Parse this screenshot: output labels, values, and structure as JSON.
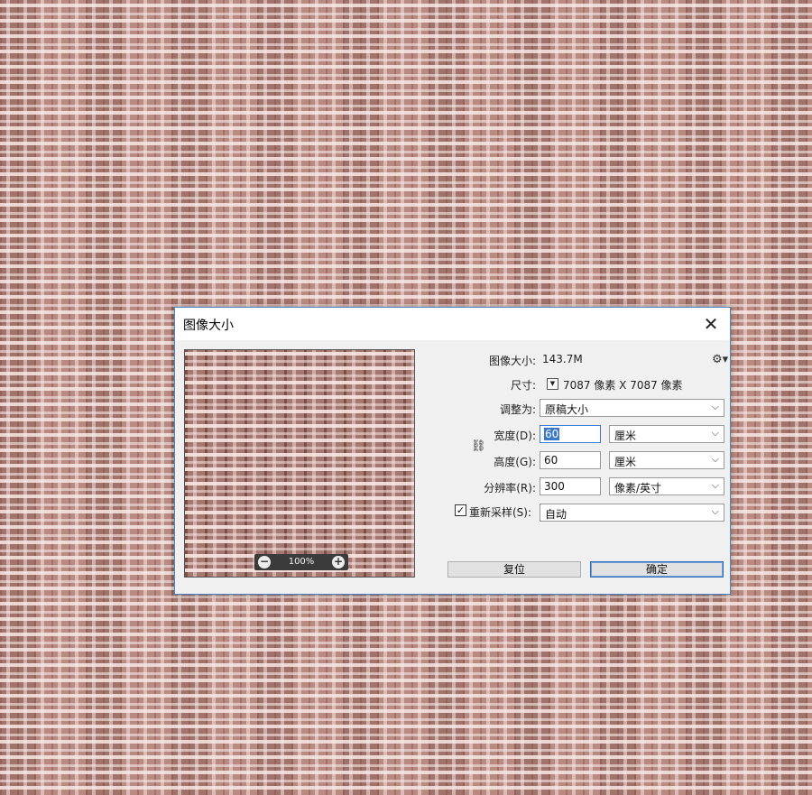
{
  "dialog": {
    "title": "图像大小",
    "close_symbol": "✕"
  },
  "preview": {
    "zoom_level": "100%",
    "zoom_out_symbol": "−",
    "zoom_in_symbol": "+"
  },
  "info": {
    "image_size_label": "图像大小:",
    "image_size_value": "143.7M",
    "dimensions_label": "尺寸:",
    "dimensions_value": "7087 像素  X  7087 像素",
    "dropdown_symbol": "▼"
  },
  "fit_to": {
    "label": "调整为:",
    "value": "原稿大小"
  },
  "width": {
    "label": "宽度(D):",
    "value": "60",
    "unit": "厘米"
  },
  "height": {
    "label": "高度(G):",
    "value": "60",
    "unit": "厘米"
  },
  "resolution": {
    "label": "分辨率(R):",
    "value": "300",
    "unit": "像素/英寸"
  },
  "resample": {
    "label": "重新采样(S):",
    "checked_symbol": "✓",
    "value": "自动"
  },
  "buttons": {
    "reset": "复位",
    "ok": "确定"
  },
  "icons": {
    "gear": "gear-icon",
    "link": "link-icon",
    "chevron": "chevron-down-icon"
  }
}
